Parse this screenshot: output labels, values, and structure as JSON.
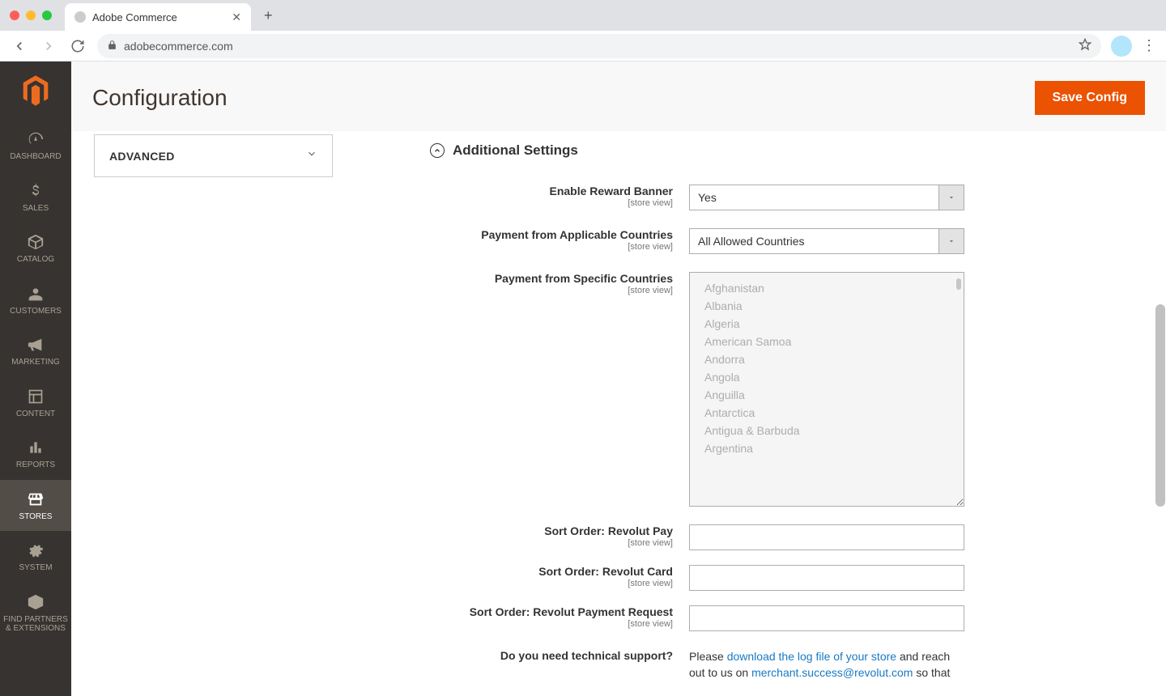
{
  "browser": {
    "tab_title": "Adobe Commerce",
    "url": "adobecommerce.com"
  },
  "sidebar": {
    "items": [
      {
        "label": "DASHBOARD"
      },
      {
        "label": "SALES"
      },
      {
        "label": "CATALOG"
      },
      {
        "label": "CUSTOMERS"
      },
      {
        "label": "MARKETING"
      },
      {
        "label": "CONTENT"
      },
      {
        "label": "REPORTS"
      },
      {
        "label": "STORES"
      },
      {
        "label": "SYSTEM"
      },
      {
        "label": "FIND PARTNERS & EXTENSIONS"
      }
    ]
  },
  "page": {
    "title": "Configuration",
    "save_label": "Save Config"
  },
  "left_section": {
    "title": "ADVANCED"
  },
  "group": {
    "title": "Additional Settings"
  },
  "fields": {
    "enable_banner": {
      "label": "Enable Reward Banner",
      "scope": "[store view]",
      "value": "Yes"
    },
    "applicable": {
      "label": "Payment from Applicable Countries",
      "scope": "[store view]",
      "value": "All Allowed Countries"
    },
    "specific": {
      "label": "Payment from Specific Countries",
      "scope": "[store view]",
      "options": [
        "Afghanistan",
        "Albania",
        "Algeria",
        "American Samoa",
        "Andorra",
        "Angola",
        "Anguilla",
        "Antarctica",
        "Antigua & Barbuda",
        "Argentina"
      ]
    },
    "sort_pay": {
      "label": "Sort Order: Revolut Pay",
      "scope": "[store view]",
      "value": ""
    },
    "sort_card": {
      "label": "Sort Order: Revolut Card",
      "scope": "[store view]",
      "value": ""
    },
    "sort_req": {
      "label": "Sort Order: Revolut Payment Request",
      "scope": "[store view]",
      "value": ""
    },
    "support": {
      "label": "Do you need technical support?",
      "pre": "Please ",
      "link1": "download the log file of your store",
      "mid": " and reach out to us on ",
      "link2": "merchant.success@revolut.com",
      "post": " so that"
    }
  }
}
